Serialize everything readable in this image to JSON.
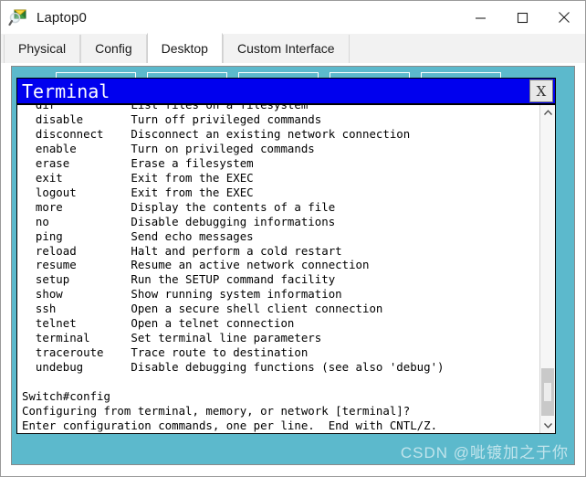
{
  "window": {
    "title": "Laptop0",
    "icon": "packet-tracer-magnifier-icon",
    "controls": {
      "minimize": "minimize-icon",
      "maximize": "maximize-icon",
      "close": "close-icon"
    }
  },
  "tabs": [
    {
      "label": "Physical",
      "active": false
    },
    {
      "label": "Config",
      "active": false
    },
    {
      "label": "Desktop",
      "active": true
    },
    {
      "label": "Custom Interface",
      "active": false
    }
  ],
  "terminal": {
    "title": "Terminal",
    "close_label": "X",
    "scrollbar": {
      "up_arrow": "chevron-up-icon",
      "down_arrow": "chevron-down-icon"
    },
    "output": "  dir           List files on a filesystem\n  disable       Turn off privileged commands\n  disconnect    Disconnect an existing network connection\n  enable        Turn on privileged commands\n  erase         Erase a filesystem\n  exit          Exit from the EXEC\n  logout        Exit from the EXEC\n  more          Display the contents of a file\n  no            Disable debugging informations\n  ping          Send echo messages\n  reload        Halt and perform a cold restart\n  resume        Resume an active network connection\n  setup         Run the SETUP command facility\n  show          Show running system information\n  ssh           Open a secure shell client connection\n  telnet        Open a telnet connection\n  terminal      Set terminal line parameters\n  traceroute    Trace route to destination\n  undebug       Disable debugging functions (see also 'debug')\n\nSwitch#config\nConfiguring from terminal, memory, or network [terminal]?\nEnter configuration commands, one per line.  End with CNTL/Z.\nSwitch(config)#"
  },
  "watermark": {
    "text": "CSDN @呲镀加之于你"
  },
  "colors": {
    "desktop_teal": "#5cb9cc",
    "terminal_title_blue": "#0000ee",
    "terminal_bg": "#ffffff",
    "terminal_fg": "#000000",
    "tab_active_bg": "#ffffff",
    "tabstrip_bg": "#f2f2f2"
  }
}
